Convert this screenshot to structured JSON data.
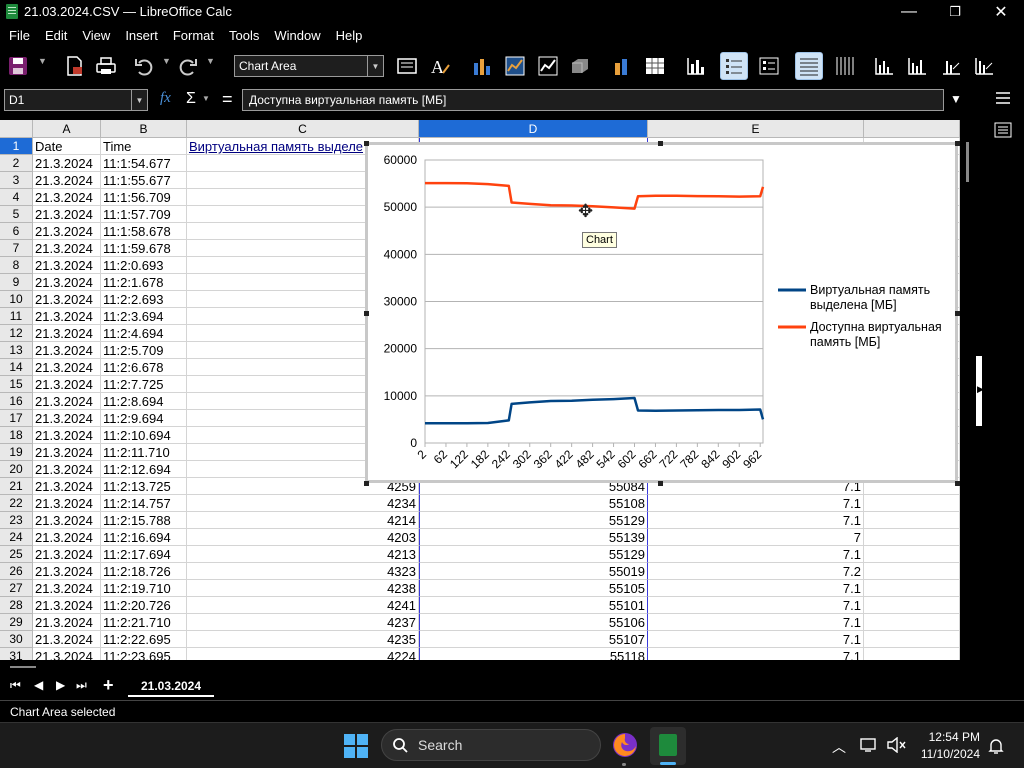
{
  "window": {
    "title": "21.03.2024.CSV — LibreOffice Calc",
    "minimize": "—",
    "restore": "❐",
    "close": "✕"
  },
  "menu": [
    "File",
    "Edit",
    "View",
    "Insert",
    "Format",
    "Tools",
    "Window",
    "Help"
  ],
  "toolbar": {
    "chart_element_select": "Chart Area"
  },
  "formula_bar": {
    "name_box": "D1",
    "function_symbol": "fx",
    "sum_symbol": "Σ",
    "equals_symbol": "=",
    "content": "Доступна виртуальная память [МБ]"
  },
  "columns": [
    "A",
    "B",
    "C",
    "D",
    "E"
  ],
  "rows": [
    {
      "n": "1",
      "a": "Date",
      "b": "Time",
      "c": "Виртуальная память выделе",
      "d": "",
      "e": ""
    },
    {
      "n": "2",
      "a": "21.3.2024",
      "b": "11:1:54.677",
      "c": "",
      "d": "",
      "e": ""
    },
    {
      "n": "3",
      "a": "21.3.2024",
      "b": "11:1:55.677",
      "c": "",
      "d": "",
      "e": ""
    },
    {
      "n": "4",
      "a": "21.3.2024",
      "b": "11:1:56.709",
      "c": "",
      "d": "",
      "e": ""
    },
    {
      "n": "5",
      "a": "21.3.2024",
      "b": "11:1:57.709",
      "c": "",
      "d": "",
      "e": ""
    },
    {
      "n": "6",
      "a": "21.3.2024",
      "b": "11:1:58.678",
      "c": "",
      "d": "",
      "e": ""
    },
    {
      "n": "7",
      "a": "21.3.2024",
      "b": "11:1:59.678",
      "c": "",
      "d": "",
      "e": ""
    },
    {
      "n": "8",
      "a": "21.3.2024",
      "b": "11:2:0.693",
      "c": "",
      "d": "",
      "e": ""
    },
    {
      "n": "9",
      "a": "21.3.2024",
      "b": "11:2:1.678",
      "c": "",
      "d": "",
      "e": ""
    },
    {
      "n": "10",
      "a": "21.3.2024",
      "b": "11:2:2.693",
      "c": "",
      "d": "",
      "e": ""
    },
    {
      "n": "11",
      "a": "21.3.2024",
      "b": "11:2:3.694",
      "c": "",
      "d": "",
      "e": ""
    },
    {
      "n": "12",
      "a": "21.3.2024",
      "b": "11:2:4.694",
      "c": "",
      "d": "",
      "e": ""
    },
    {
      "n": "13",
      "a": "21.3.2024",
      "b": "11:2:5.709",
      "c": "",
      "d": "",
      "e": ""
    },
    {
      "n": "14",
      "a": "21.3.2024",
      "b": "11:2:6.678",
      "c": "",
      "d": "",
      "e": ""
    },
    {
      "n": "15",
      "a": "21.3.2024",
      "b": "11:2:7.725",
      "c": "",
      "d": "",
      "e": ""
    },
    {
      "n": "16",
      "a": "21.3.2024",
      "b": "11:2:8.694",
      "c": "",
      "d": "",
      "e": ""
    },
    {
      "n": "17",
      "a": "21.3.2024",
      "b": "11:2:9.694",
      "c": "",
      "d": "",
      "e": ""
    },
    {
      "n": "18",
      "a": "21.3.2024",
      "b": "11:2:10.694",
      "c": "",
      "d": "",
      "e": ""
    },
    {
      "n": "19",
      "a": "21.3.2024",
      "b": "11:2:11.710",
      "c": "",
      "d": "",
      "e": ""
    },
    {
      "n": "20",
      "a": "21.3.2024",
      "b": "11:2:12.694",
      "c": "",
      "d": "",
      "e": ""
    },
    {
      "n": "21",
      "a": "21.3.2024",
      "b": "11:2:13.725",
      "c": "4259",
      "d": "55084",
      "e": "7.1"
    },
    {
      "n": "22",
      "a": "21.3.2024",
      "b": "11:2:14.757",
      "c": "4234",
      "d": "55108",
      "e": "7.1"
    },
    {
      "n": "23",
      "a": "21.3.2024",
      "b": "11:2:15.788",
      "c": "4214",
      "d": "55129",
      "e": "7.1"
    },
    {
      "n": "24",
      "a": "21.3.2024",
      "b": "11:2:16.694",
      "c": "4203",
      "d": "55139",
      "e": "7"
    },
    {
      "n": "25",
      "a": "21.3.2024",
      "b": "11:2:17.694",
      "c": "4213",
      "d": "55129",
      "e": "7.1"
    },
    {
      "n": "26",
      "a": "21.3.2024",
      "b": "11:2:18.726",
      "c": "4323",
      "d": "55019",
      "e": "7.2"
    },
    {
      "n": "27",
      "a": "21.3.2024",
      "b": "11:2:19.710",
      "c": "4238",
      "d": "55105",
      "e": "7.1"
    },
    {
      "n": "28",
      "a": "21.3.2024",
      "b": "11:2:20.726",
      "c": "4241",
      "d": "55101",
      "e": "7.1"
    },
    {
      "n": "29",
      "a": "21.3.2024",
      "b": "11:2:21.710",
      "c": "4237",
      "d": "55106",
      "e": "7.1"
    },
    {
      "n": "30",
      "a": "21.3.2024",
      "b": "11:2:22.695",
      "c": "4235",
      "d": "55107",
      "e": "7.1"
    },
    {
      "n": "31",
      "a": "21.3.2024",
      "b": "11:2:23.695",
      "c": "4224",
      "d": "55118",
      "e": "7.1"
    }
  ],
  "chart_tooltip": "Chart",
  "chart_data": {
    "type": "line",
    "title": "",
    "xlabel": "",
    "ylabel": "",
    "ylim": [
      0,
      60000
    ],
    "yticks": [
      "0",
      "10000",
      "20000",
      "30000",
      "40000",
      "50000",
      "60000"
    ],
    "xticks": [
      "2",
      "62",
      "122",
      "182",
      "242",
      "302",
      "362",
      "422",
      "482",
      "542",
      "602",
      "662",
      "722",
      "782",
      "842",
      "902",
      "962"
    ],
    "grid": "horizontal",
    "legend": "right",
    "x": [
      2,
      62,
      122,
      182,
      242,
      250,
      302,
      362,
      422,
      482,
      542,
      602,
      612,
      662,
      722,
      782,
      842,
      902,
      962,
      970
    ],
    "series": [
      {
        "name": "Виртуальная память выделена [МБ]",
        "color": "#004586",
        "values": [
          4200,
          4200,
          4200,
          4250,
          4800,
          8300,
          8600,
          8900,
          8950,
          9150,
          9300,
          9550,
          6900,
          6850,
          6900,
          6950,
          7000,
          7000,
          7100,
          5000
        ]
      },
      {
        "name": "Доступна виртуальная память [МБ]",
        "color": "#ff420e",
        "values": [
          55100,
          55100,
          55050,
          54900,
          54500,
          51000,
          50700,
          50400,
          50350,
          50200,
          49950,
          49700,
          52300,
          52400,
          52400,
          52350,
          52300,
          52250,
          52300,
          54300
        ]
      }
    ]
  },
  "sheet_tab": "21.03.2024",
  "status": "Chart Area selected",
  "taskbar": {
    "search_placeholder": "Search",
    "time": "12:54 PM",
    "date": "11/10/2024"
  }
}
